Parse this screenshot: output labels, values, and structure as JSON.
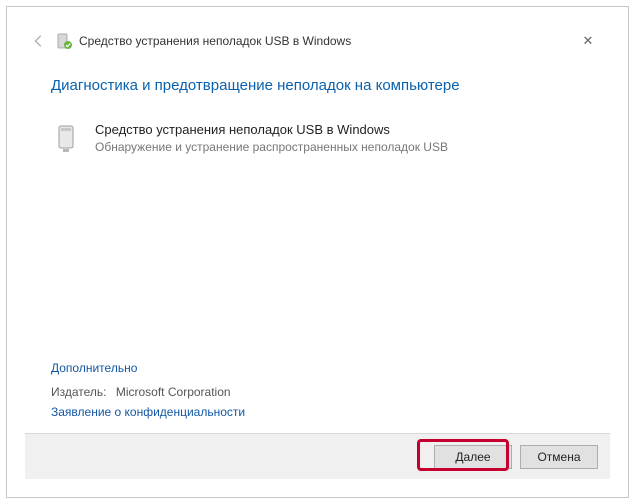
{
  "window": {
    "title": "Средство устранения неполадок USB в Windows",
    "close_label": "✕"
  },
  "main": {
    "heading": "Диагностика и предотвращение неполадок на компьютере",
    "troubleshooter": {
      "name": "Средство устранения неполадок USB в Windows",
      "description": "Обнаружение и устранение распространенных неполадок USB"
    },
    "advanced_link": "Дополнительно",
    "publisher_label": "Издатель:",
    "publisher_value": "Microsoft Corporation",
    "privacy_link": "Заявление о конфиденциальности"
  },
  "footer": {
    "next_label": "Далее",
    "cancel_label": "Отмена"
  }
}
